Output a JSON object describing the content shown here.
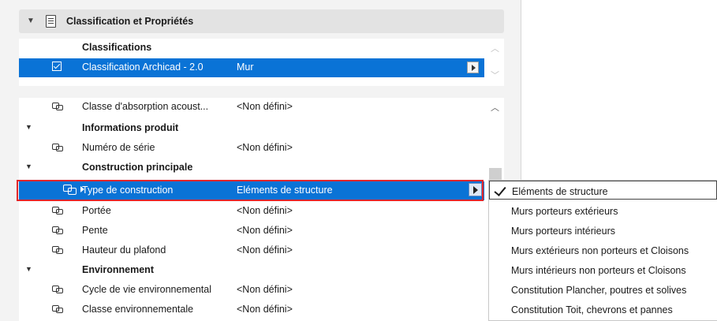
{
  "section": {
    "title": "Classification et Propriétés",
    "arrow": "▼"
  },
  "classifications": {
    "header": "Classifications",
    "row": {
      "system": "Classification Archicad - 2.0",
      "value": "Mur"
    }
  },
  "properties": {
    "top_row": {
      "name": "Classe d'absorption acoust...",
      "value": "<Non défini>"
    },
    "groups": [
      {
        "title": "Informations produit",
        "rows": [
          {
            "name": "Numéro de série",
            "value": "<Non défini>"
          }
        ]
      },
      {
        "title": "Construction principale",
        "selected_row": {
          "name": "Type de construction",
          "value": "Eléments de structure"
        },
        "rows": [
          {
            "name": "Portée",
            "value": "<Non défini>"
          },
          {
            "name": "Pente",
            "value": "<Non défini>"
          },
          {
            "name": "Hauteur du plafond",
            "value": "<Non défini>"
          }
        ]
      },
      {
        "title": "Environnement",
        "rows": [
          {
            "name": "Cycle de vie environnemental",
            "value": "<Non défini>"
          },
          {
            "name": "Classe environnementale",
            "value": "<Non défini>"
          }
        ]
      }
    ]
  },
  "dropdown": {
    "selected_index": 0,
    "options": [
      "Eléments de structure",
      "Murs porteurs extérieurs",
      "Murs porteurs intérieurs",
      "Murs extérieurs non porteurs et Cloisons",
      "Murs intérieurs non porteurs et Cloisons",
      "Constitution Plancher, poutres et solives",
      "Constitution Toit, chevrons et pannes"
    ]
  },
  "colors": {
    "selection": "#0a73d6",
    "highlight_outline": "#e2262a",
    "panel_bg": "#f3f3f3"
  },
  "icons": {
    "section_arrow": "triangle-down-icon",
    "section": "document-icon",
    "link": "linked-property-icon",
    "check": "checkmark-icon",
    "cursor": "mouse-pointer-icon"
  }
}
